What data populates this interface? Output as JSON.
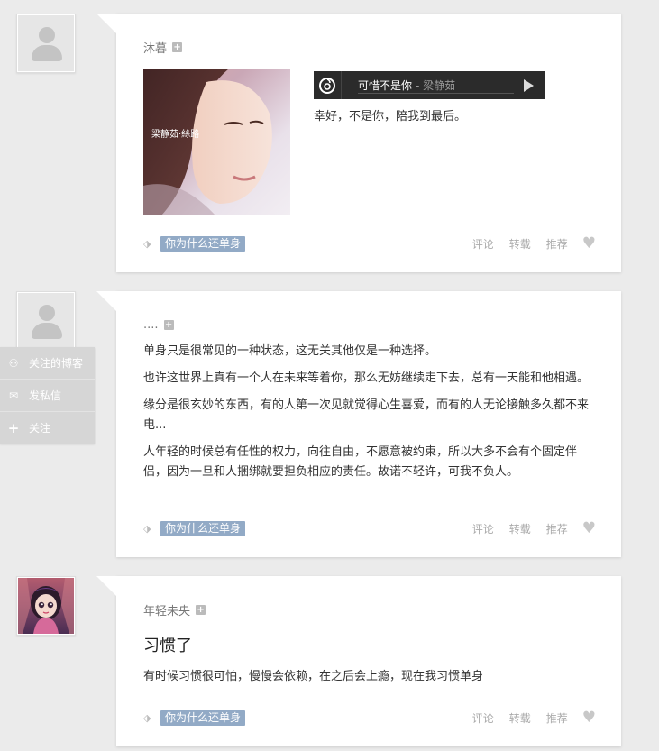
{
  "posts": [
    {
      "author": "沐暮",
      "music": {
        "song": "可惜不是你",
        "singer": "- 梁静茹",
        "cover_text": "梁静茹·絲路"
      },
      "caption": "幸好，不是你，陪我到最后。",
      "tag": "你为什么还单身",
      "actions": {
        "comment": "评论",
        "reblog": "转载",
        "recommend": "推荐"
      }
    },
    {
      "author": "....",
      "paragraphs": [
        "单身只是很常见的一种状态，这无关其他仅是一种选择。",
        "也许这世界上真有一个人在未来等着你，那么无妨继续走下去，总有一天能和他相遇。",
        "缘分是很玄妙的东西，有的人第一次见就觉得心生喜爱，而有的人无论接触多久都不来电...",
        "人年轻的时候总有任性的权力，向往自由，不愿意被约束，所以大多不会有个固定伴侣，因为一旦和人捆绑就要担负相应的责任。故诺不轻许，可我不负人。"
      ],
      "tag": "你为什么还单身",
      "actions": {
        "comment": "评论",
        "reblog": "转载",
        "recommend": "推荐"
      }
    },
    {
      "author": "年轻未央",
      "title": "习惯了",
      "body": "有时候习惯很可怕，慢慢会依赖，在之后会上瘾，现在我习惯单身",
      "tag": "你为什么还单身",
      "actions": {
        "comment": "评论",
        "reblog": "转载",
        "recommend": "推荐"
      }
    }
  ],
  "side_menu": {
    "follow_blog": "关注的博客",
    "message": "发私信",
    "follow": "关注"
  },
  "icons": {
    "avatar": "user-placeholder-icon",
    "tag": "tag-icon",
    "heart": "heart-icon",
    "music": "netease-music-icon",
    "play": "play-icon"
  },
  "colors": {
    "tag_bg": "#92aac6",
    "page_bg": "#ebebeb",
    "player_bg": "#2b2b2b"
  }
}
